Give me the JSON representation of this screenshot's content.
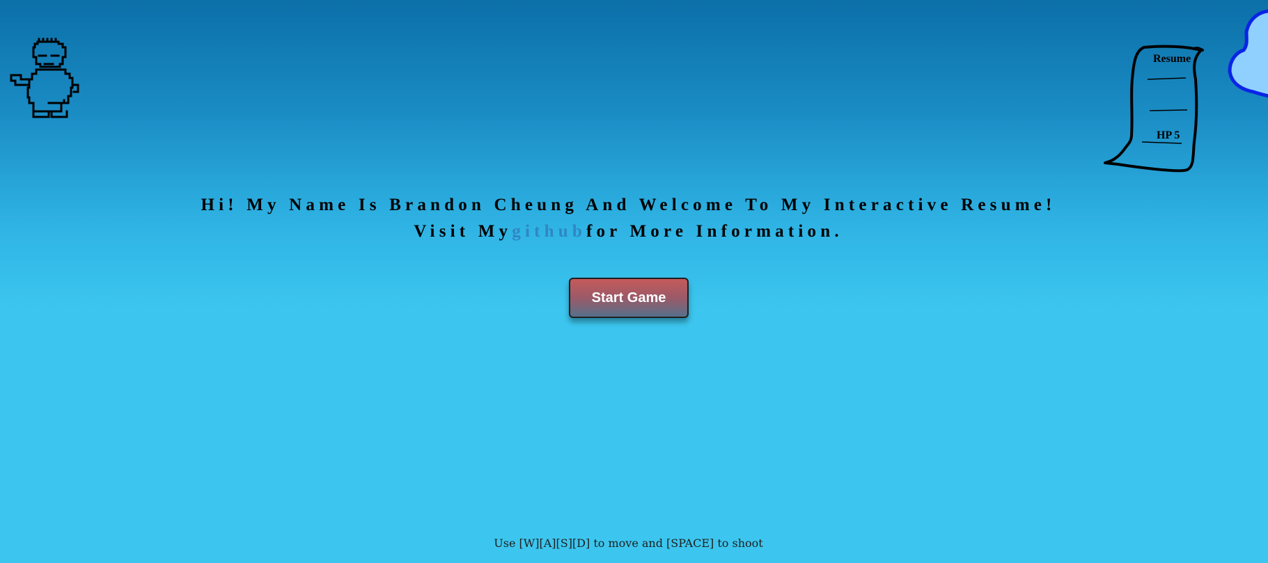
{
  "headline": {
    "line1": "Hi! My Name Is Brandon Cheung And Welcome To My Interactive Resume!",
    "line2_prefix": "Visit My",
    "link_text": "github",
    "line2_suffix": "for More Information."
  },
  "start_button": {
    "label": "Start Game"
  },
  "resume_item": {
    "title": "Resume",
    "hp": "HP 5"
  },
  "instructions": "Use [W][A][S][D] to move and [SPACE] to shoot",
  "colors": {
    "sky_top": "#0c6fa8",
    "sky_bottom": "#3cc6ef",
    "link": "#2f87c2",
    "button_top": "#c45a5a",
    "button_bottom": "#56708a",
    "cloud_fill": "#8fd0ff",
    "cloud_stroke": "#0a24e6"
  },
  "icons": {
    "player": "player-sprite-icon",
    "scroll": "resume-scroll-icon",
    "cloud": "cloud-icon"
  }
}
